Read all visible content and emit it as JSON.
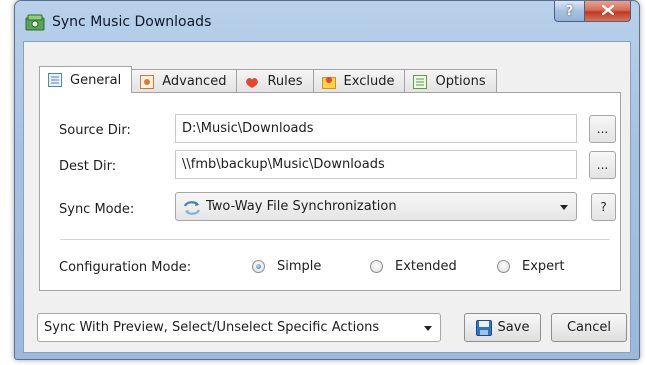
{
  "window": {
    "title": "Sync Music Downloads",
    "icons": {
      "app": "music-sync-icon",
      "help": "help-icon",
      "close": "close-icon"
    },
    "help_label": "?"
  },
  "tabs": [
    {
      "label": "General",
      "icon": "general-icon",
      "active": true
    },
    {
      "label": "Advanced",
      "icon": "advanced-icon",
      "active": false
    },
    {
      "label": "Rules",
      "icon": "rules-icon",
      "active": false
    },
    {
      "label": "Exclude",
      "icon": "exclude-icon",
      "active": false
    },
    {
      "label": "Options",
      "icon": "options-icon",
      "active": false
    }
  ],
  "general": {
    "source_label": "Source Dir:",
    "source_value": "D:\\Music\\Downloads",
    "dest_label": "Dest Dir:",
    "dest_value": "\\\\fmb\\backup\\Music\\Downloads",
    "browse_label": "...",
    "sync_mode_label": "Sync Mode:",
    "sync_mode_value": "Two-Way File Synchronization",
    "sync_mode_icon": "sync-arrows-icon",
    "sync_help_label": "?",
    "config_label": "Configuration Mode:",
    "config_options": [
      {
        "label": "Simple",
        "selected": true
      },
      {
        "label": "Extended",
        "selected": false
      },
      {
        "label": "Expert",
        "selected": false
      }
    ]
  },
  "footer": {
    "action_value": "Sync With Preview, Select/Unselect Specific Actions",
    "save_label": "Save",
    "save_icon": "floppy-disk-icon",
    "cancel_label": "Cancel"
  },
  "colors": {
    "accent": "#2d6fb3",
    "close": "#c0391f"
  }
}
